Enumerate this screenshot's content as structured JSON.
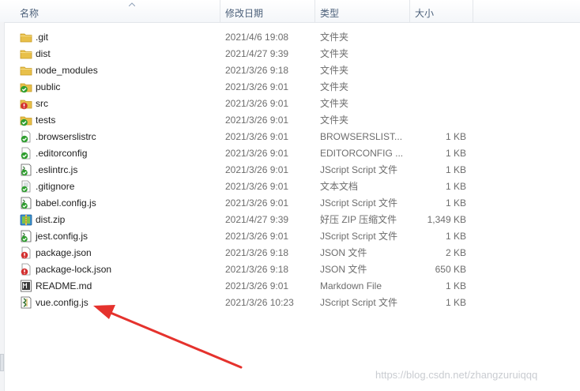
{
  "columns": {
    "name": "名称",
    "date": "修改日期",
    "type": "类型",
    "size": "大小"
  },
  "files": [
    {
      "name": ".git",
      "date": "2021/4/6 19:08",
      "type": "文件夹",
      "size": "",
      "icon": "folder-icon"
    },
    {
      "name": "dist",
      "date": "2021/4/27 9:39",
      "type": "文件夹",
      "size": "",
      "icon": "folder-icon"
    },
    {
      "name": "node_modules",
      "date": "2021/3/26 9:18",
      "type": "文件夹",
      "size": "",
      "icon": "folder-icon"
    },
    {
      "name": "public",
      "date": "2021/3/26 9:01",
      "type": "文件夹",
      "size": "",
      "icon": "folder-sync-ok-icon"
    },
    {
      "name": "src",
      "date": "2021/3/26 9:01",
      "type": "文件夹",
      "size": "",
      "icon": "folder-sync-modified-icon"
    },
    {
      "name": "tests",
      "date": "2021/3/26 9:01",
      "type": "文件夹",
      "size": "",
      "icon": "folder-sync-ok-icon"
    },
    {
      "name": ".browserslistrc",
      "date": "2021/3/26 9:01",
      "type": "BROWSERSLIST...",
      "size": "1 KB",
      "icon": "file-sync-ok-icon"
    },
    {
      "name": ".editorconfig",
      "date": "2021/3/26 9:01",
      "type": "EDITORCONFIG ...",
      "size": "1 KB",
      "icon": "file-sync-ok-icon"
    },
    {
      "name": ".eslintrc.js",
      "date": "2021/3/26 9:01",
      "type": "JScript Script 文件",
      "size": "1 KB",
      "icon": "script-file-sync-ok-icon"
    },
    {
      "name": ".gitignore",
      "date": "2021/3/26 9:01",
      "type": "文本文档",
      "size": "1 KB",
      "icon": "text-file-sync-ok-icon"
    },
    {
      "name": "babel.config.js",
      "date": "2021/3/26 9:01",
      "type": "JScript Script 文件",
      "size": "1 KB",
      "icon": "script-file-sync-ok-icon"
    },
    {
      "name": "dist.zip",
      "date": "2021/4/27 9:39",
      "type": "好压 ZIP 压缩文件",
      "size": "1,349 KB",
      "icon": "zip-archive-icon"
    },
    {
      "name": "jest.config.js",
      "date": "2021/3/26 9:01",
      "type": "JScript Script 文件",
      "size": "1 KB",
      "icon": "script-file-sync-ok-icon"
    },
    {
      "name": "package.json",
      "date": "2021/3/26 9:18",
      "type": "JSON 文件",
      "size": "2 KB",
      "icon": "file-sync-modified-icon"
    },
    {
      "name": "package-lock.json",
      "date": "2021/3/26 9:18",
      "type": "JSON 文件",
      "size": "650 KB",
      "icon": "file-sync-modified-icon"
    },
    {
      "name": "README.md",
      "date": "2021/3/26 9:01",
      "type": "Markdown File",
      "size": "1 KB",
      "icon": "markdown-file-icon"
    },
    {
      "name": "vue.config.js",
      "date": "2021/3/26 10:23",
      "type": "JScript Script 文件",
      "size": "1 KB",
      "icon": "script-file-icon"
    }
  ],
  "watermark": "https://blog.csdn.net/zhangzuruiqqq",
  "colors": {
    "folder": "#e8c04a",
    "sync_ok": "#2f9e2f",
    "sync_modified": "#d32f2f",
    "annotation_arrow": "#e5322d"
  }
}
